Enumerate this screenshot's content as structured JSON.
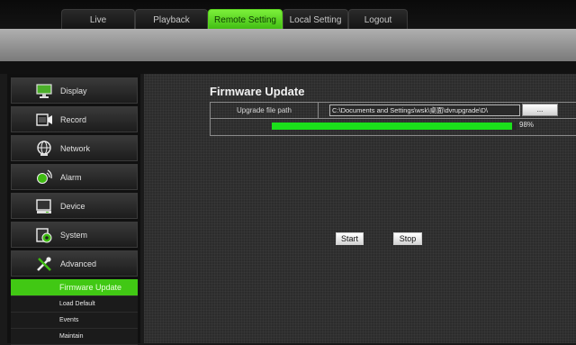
{
  "nav": {
    "tabs": [
      {
        "label": "Live",
        "active": false
      },
      {
        "label": "Playback",
        "active": false
      },
      {
        "label": "Remote Setting",
        "active": true
      },
      {
        "label": "Local Setting",
        "active": false
      },
      {
        "label": "Logout",
        "active": false
      }
    ]
  },
  "sidebar": {
    "items": [
      {
        "label": "Display",
        "icon": "monitor-icon"
      },
      {
        "label": "Record",
        "icon": "camera-icon"
      },
      {
        "label": "Network",
        "icon": "globe-icon"
      },
      {
        "label": "Alarm",
        "icon": "alarm-icon"
      },
      {
        "label": "Device",
        "icon": "hard-drive-icon"
      },
      {
        "label": "System",
        "icon": "system-gear-icon"
      },
      {
        "label": "Advanced",
        "icon": "tools-icon"
      }
    ],
    "subitems": [
      {
        "label": "Firmware Update",
        "active": true
      },
      {
        "label": "Load Default",
        "active": false
      },
      {
        "label": "Events",
        "active": false
      },
      {
        "label": "Maintain",
        "active": false
      }
    ]
  },
  "firmware": {
    "title": "Firmware Update",
    "path_label": "Upgrade file path",
    "path_value": "C:\\Documents and Settings\\wsk\\桌面\\dvrupgrade\\D\\",
    "browse_label": "...",
    "progress": 0.98,
    "progress_text": "98%",
    "start_label": "Start",
    "stop_label": "Stop"
  },
  "colors": {
    "accent_green": "#41c814",
    "progress_green": "#1be01b"
  }
}
